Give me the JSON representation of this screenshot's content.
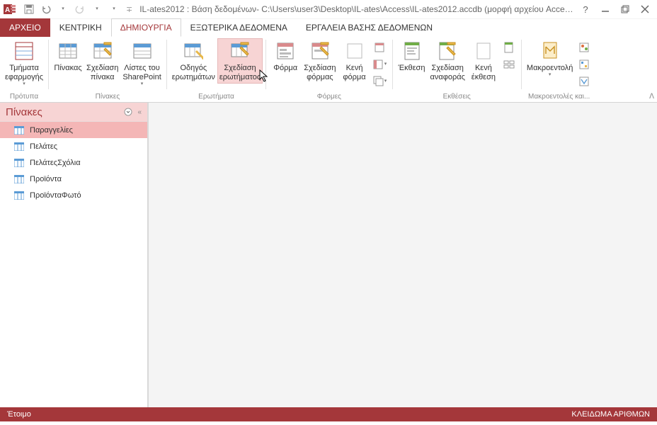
{
  "title": "IL-ates2012 : Βάση δεδομένων- C:\\Users\\user3\\Desktop\\IL-ates\\Access\\IL-ates2012.accdb (μορφή αρχείου Access 200...",
  "tabs": {
    "file": "ΑΡΧΕΙΟ",
    "home": "ΚΕΝΤΡΙΚΗ",
    "create": "ΔΗΜΙΟΥΡΓΙΑ",
    "external": "ΕΞΩΤΕΡΙΚΑ ΔΕΔΟΜΕΝΑ",
    "dbtools": "ΕΡΓΑΛΕΙΑ ΒΑΣΗΣ ΔΕΔΟΜΕΝΩΝ"
  },
  "ribbon": {
    "templates": {
      "app_parts": "Τμήματα\nεφαρμογής",
      "group": "Πρότυπα"
    },
    "tables": {
      "table": "Πίνακας",
      "design": "Σχεδίαση\nπίνακα",
      "sharepoint": "Λίστες του\nSharePoint",
      "group": "Πίνακες"
    },
    "queries": {
      "wizard": "Οδηγός\nερωτημάτων",
      "design": "Σχεδίαση\nερωτήματος",
      "group": "Ερωτήματα"
    },
    "forms": {
      "form": "Φόρμα",
      "design": "Σχεδίαση\nφόρμας",
      "blank": "Κενή\nφόρμα",
      "group": "Φόρμες"
    },
    "reports": {
      "report": "Έκθεση",
      "design": "Σχεδίαση\nαναφοράς",
      "blank": "Κενή\nέκθεση",
      "group": "Εκθέσεις"
    },
    "macros": {
      "macro": "Μακροεντολή",
      "group": "Μακροεντολές και..."
    }
  },
  "nav": {
    "header": "Πίνακες",
    "items": [
      "Παραγγελίες",
      "Πελάτες",
      "ΠελάτεςΣχόλια",
      "Προϊόντα",
      "ΠροϊόνταΦωτό"
    ]
  },
  "status": {
    "left": "Έτοιμο",
    "right": "ΚΛΕΙΔΩΜΑ ΑΡΙΘΜΩΝ"
  },
  "colors": {
    "accent": "#a4373a"
  }
}
